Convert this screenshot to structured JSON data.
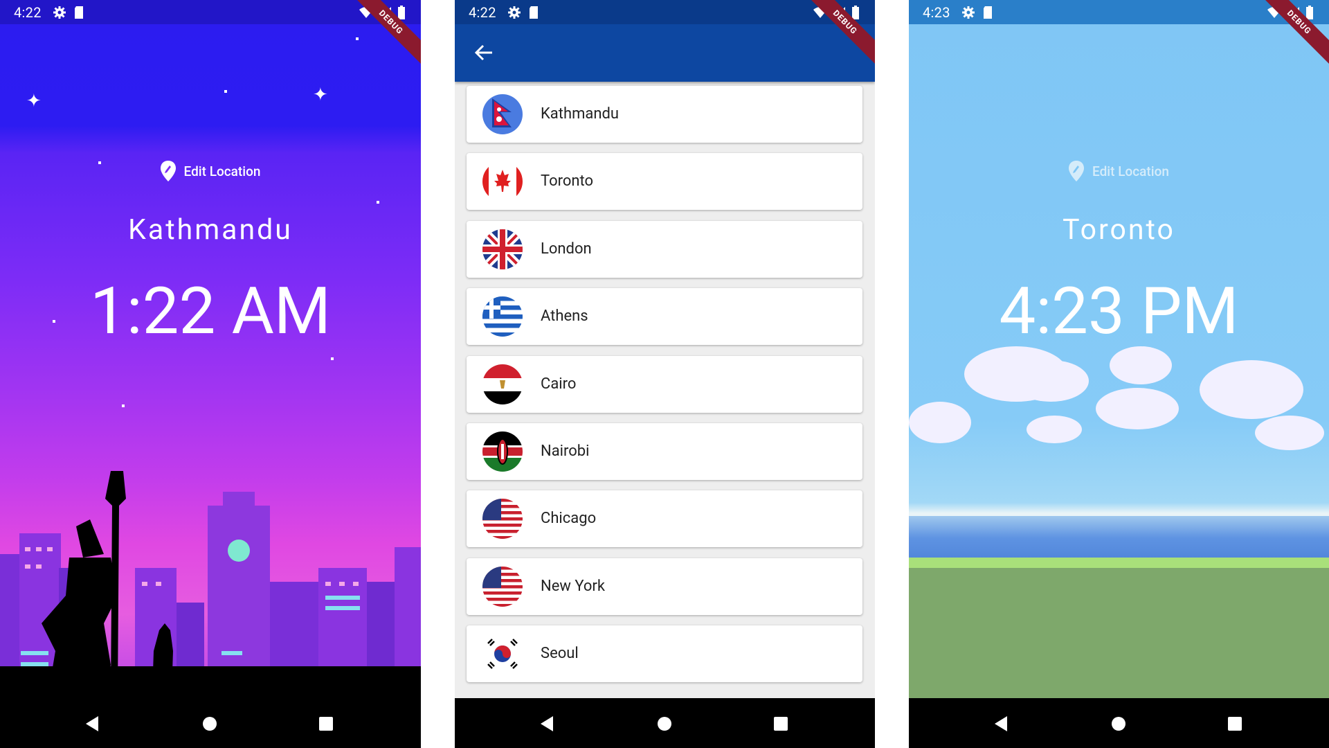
{
  "colors": {
    "night_sky_top": "#2c1cf0",
    "night_sky_bottom": "#e048e2",
    "appbar": "#0d47a1",
    "day_sky": "#7fc6f5",
    "grass": "#7ea86b",
    "debug_ribbon": "#8b1a2e"
  },
  "phones": {
    "home_night": {
      "status_time": "4:22",
      "debug_label": "DEBUG",
      "edit_location_label": "Edit Location",
      "location": "Kathmandu",
      "time": "1:22 AM"
    },
    "choose_location": {
      "status_time": "4:22",
      "debug_label": "DEBUG",
      "locations": [
        {
          "name": "Kathmandu",
          "flag_icon": "nepal-flag-icon"
        },
        {
          "name": "Toronto",
          "flag_icon": "canada-flag-icon"
        },
        {
          "name": "London",
          "flag_icon": "uk-flag-icon"
        },
        {
          "name": "Athens",
          "flag_icon": "greece-flag-icon"
        },
        {
          "name": "Cairo",
          "flag_icon": "egypt-flag-icon"
        },
        {
          "name": "Nairobi",
          "flag_icon": "kenya-flag-icon"
        },
        {
          "name": "Chicago",
          "flag_icon": "usa-flag-icon"
        },
        {
          "name": "New York",
          "flag_icon": "usa-flag-icon"
        },
        {
          "name": "Seoul",
          "flag_icon": "south-korea-flag-icon"
        }
      ]
    },
    "home_day": {
      "status_time": "4:23",
      "debug_label": "DEBUG",
      "edit_location_label": "Edit Location",
      "location": "Toronto",
      "time": "4:23 PM"
    }
  }
}
